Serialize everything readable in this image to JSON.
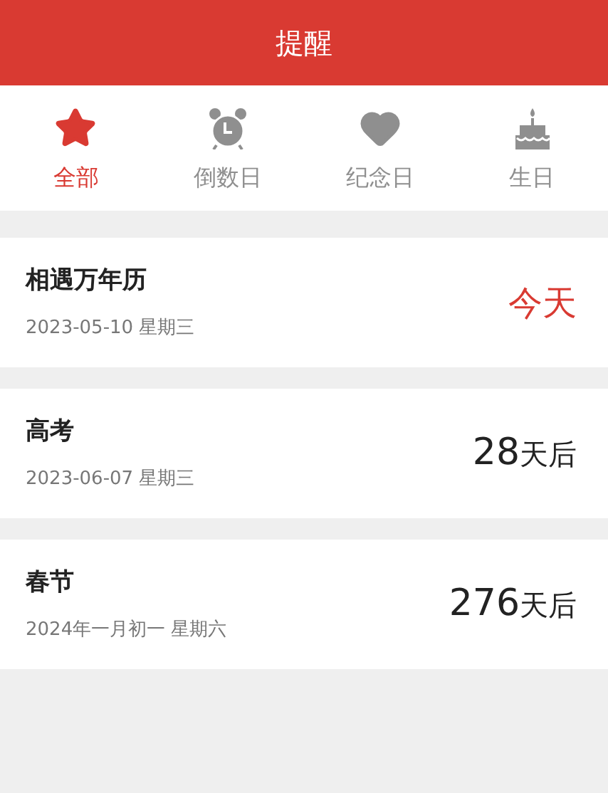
{
  "header": {
    "title": "提醒"
  },
  "tabs": [
    {
      "label": "全部",
      "kind": "star",
      "selected": true
    },
    {
      "label": "倒数日",
      "kind": "alarm",
      "selected": false
    },
    {
      "label": "纪念日",
      "kind": "heart",
      "selected": false
    },
    {
      "label": "生日",
      "kind": "cake",
      "selected": false
    }
  ],
  "events": [
    {
      "name": "相遇万年历",
      "date": "2023-05-10 星期三",
      "kind": "today",
      "label": "今天"
    },
    {
      "name": "高考",
      "date": "2023-06-07 星期三",
      "kind": "countdown",
      "days": "28",
      "unit": "天后"
    },
    {
      "name": "春节",
      "date": "2024年一月初一 星期六",
      "kind": "countdown",
      "days": "276",
      "unit": "天后"
    }
  ]
}
